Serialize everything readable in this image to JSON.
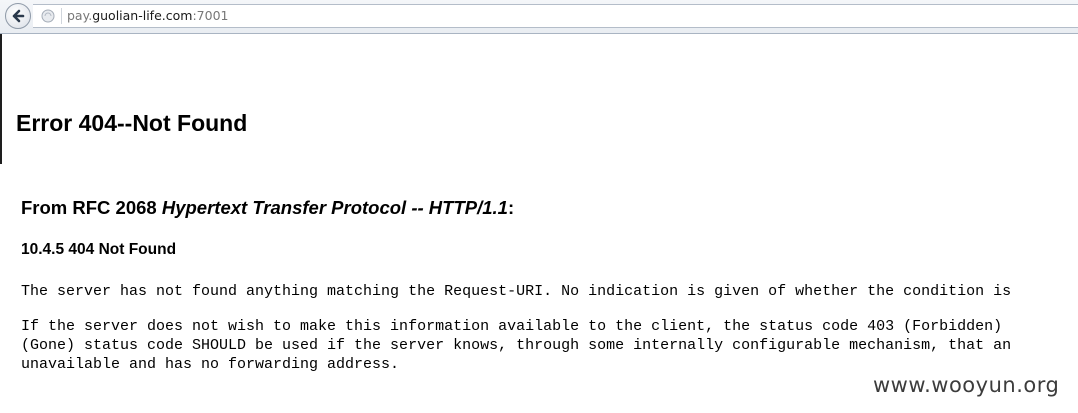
{
  "browser": {
    "back_icon": "back-arrow-icon",
    "site_icon": "globe-icon",
    "url_prefix": "pay.",
    "url_host": "guolian-life.com",
    "url_suffix": ":7001"
  },
  "page": {
    "title": "Error 404--Not Found",
    "rfc_prefix": "From RFC 2068 ",
    "rfc_italic": "Hypertext Transfer Protocol -- HTTP/1.1",
    "rfc_suffix": ":",
    "section_heading": "10.4.5 404 Not Found",
    "paragraph1": "The server has not found anything matching the Request-URI. No indication is given of whether the condition is",
    "paragraph2": "If the server does not wish to make this information available to the client, the status code 403 (Forbidden)\n(Gone) status code SHOULD be used if the server knows, through some internally configurable mechanism, that an\nunavailable and has no forwarding address."
  },
  "watermark": "www.wooyun.org"
}
